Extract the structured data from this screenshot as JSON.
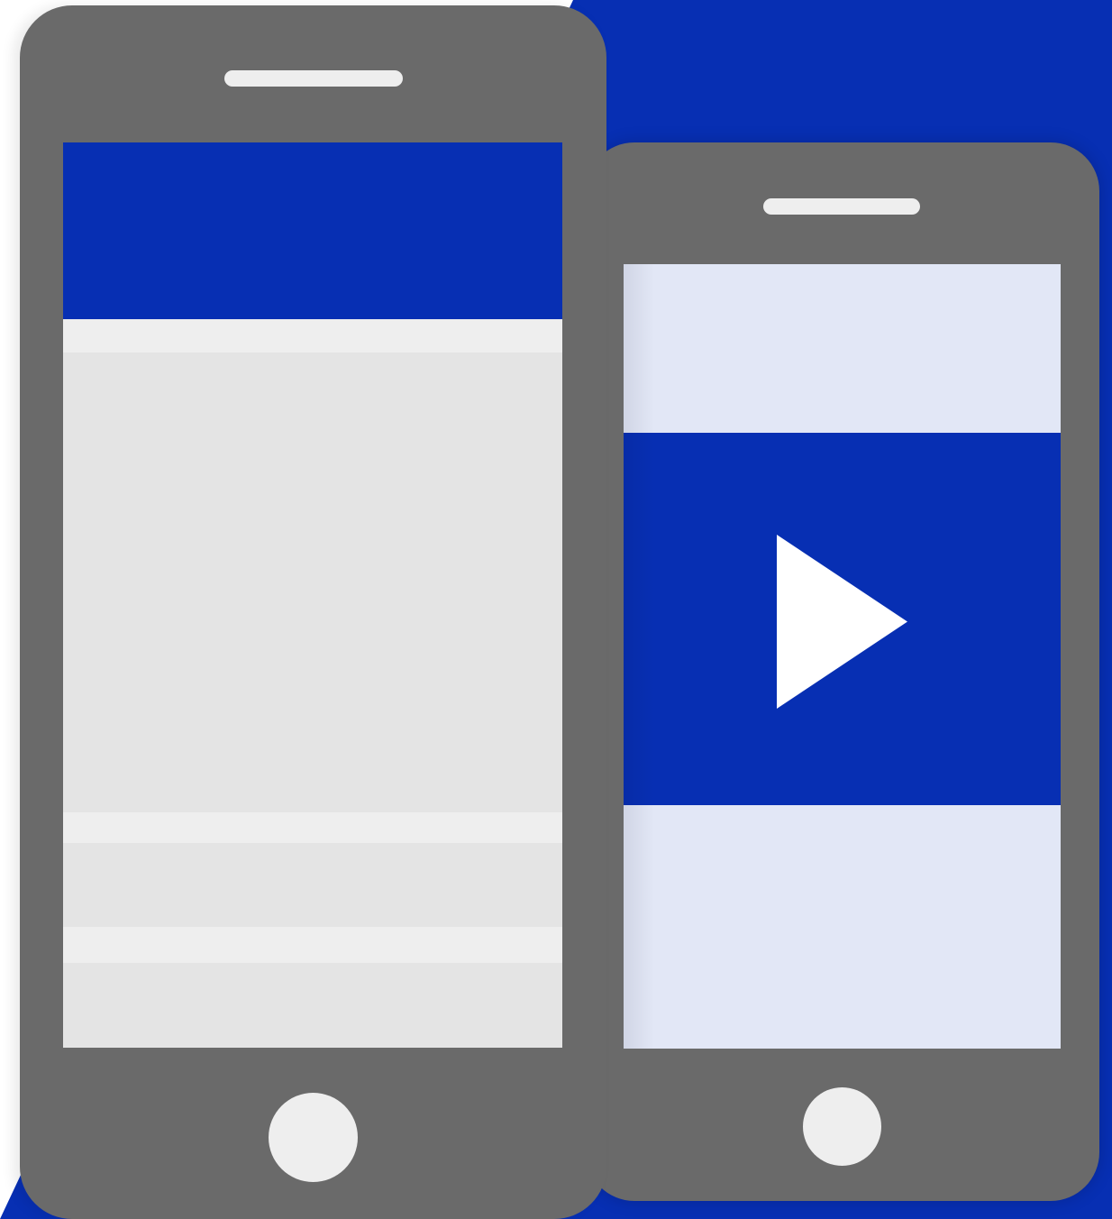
{
  "illustration": {
    "colors": {
      "brand_blue": "#072fb3",
      "device_gray": "#6a6a6a",
      "device_light": "#eeeeee",
      "screen_gray": "#e4e4e4",
      "video_screen_background": "#e2e7f6",
      "play_icon": "#ffffff"
    },
    "devices": [
      {
        "name": "content-phone",
        "screen_blocks": [
          "header",
          "strip",
          "content-card",
          "strip",
          "content-card",
          "strip",
          "content-card"
        ]
      },
      {
        "name": "video-phone",
        "screen_blocks": [
          "video-top",
          "video-panel",
          "video-bottom"
        ],
        "icons": [
          "play-icon"
        ]
      }
    ]
  }
}
